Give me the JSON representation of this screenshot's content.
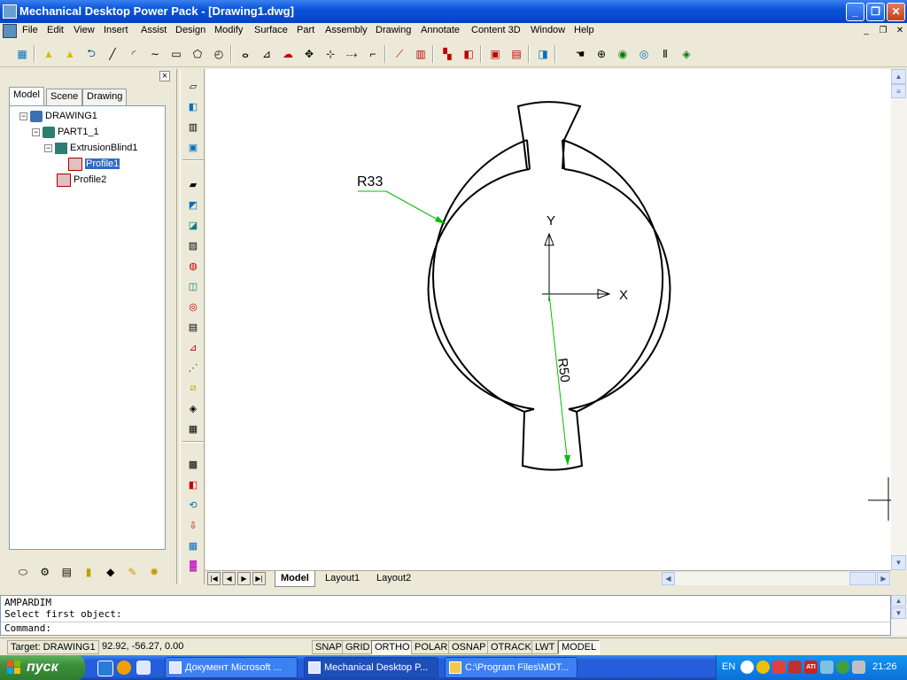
{
  "window": {
    "title": "Mechanical Desktop Power Pack - [Drawing1.dwg]"
  },
  "menu": [
    "File",
    "Edit",
    "View",
    "Insert",
    "Assist",
    "Design",
    "Modify",
    "Surface",
    "Part",
    "Assembly",
    "Drawing",
    "Annotate",
    "Content 3D",
    "Window",
    "Help"
  ],
  "browser": {
    "tabs": [
      "Model",
      "Scene",
      "Drawing"
    ],
    "tree": [
      {
        "label": "DRAWING1",
        "expander": "−"
      },
      {
        "label": "PART1_1",
        "expander": "−"
      },
      {
        "label": "ExtrusionBlind1",
        "expander": "−"
      },
      {
        "label": "Profile1",
        "expander": ""
      },
      {
        "label": "Profile2",
        "expander": ""
      }
    ]
  },
  "drawing": {
    "dim_inner": "R33",
    "dim_outer": "R50",
    "axis_x": "X",
    "axis_y": "Y"
  },
  "layout_tabs": [
    "Model",
    "Layout1",
    "Layout2"
  ],
  "command": {
    "line1": "AMPARDIM",
    "line2": "Select first object:",
    "line3": "Command:"
  },
  "status": {
    "target": "Target: DRAWING1",
    "coords": "92.92,  -56.27, 0.00",
    "toggles": [
      "SNAP",
      "GRID",
      "ORTHO",
      "POLAR",
      "OSNAP",
      "OTRACK",
      "LWT",
      "MODEL"
    ]
  },
  "taskbar": {
    "start": "пуск",
    "tasks": [
      "Документ Microsoft ...",
      "Mechanical Desktop P...",
      "C:\\Program Files\\MDT..."
    ],
    "lang": "EN",
    "clock": "21:26"
  },
  "colors": {
    "titlebar": "#0a55d8",
    "dimension": "#00c000",
    "taskbar": "#245edb"
  }
}
